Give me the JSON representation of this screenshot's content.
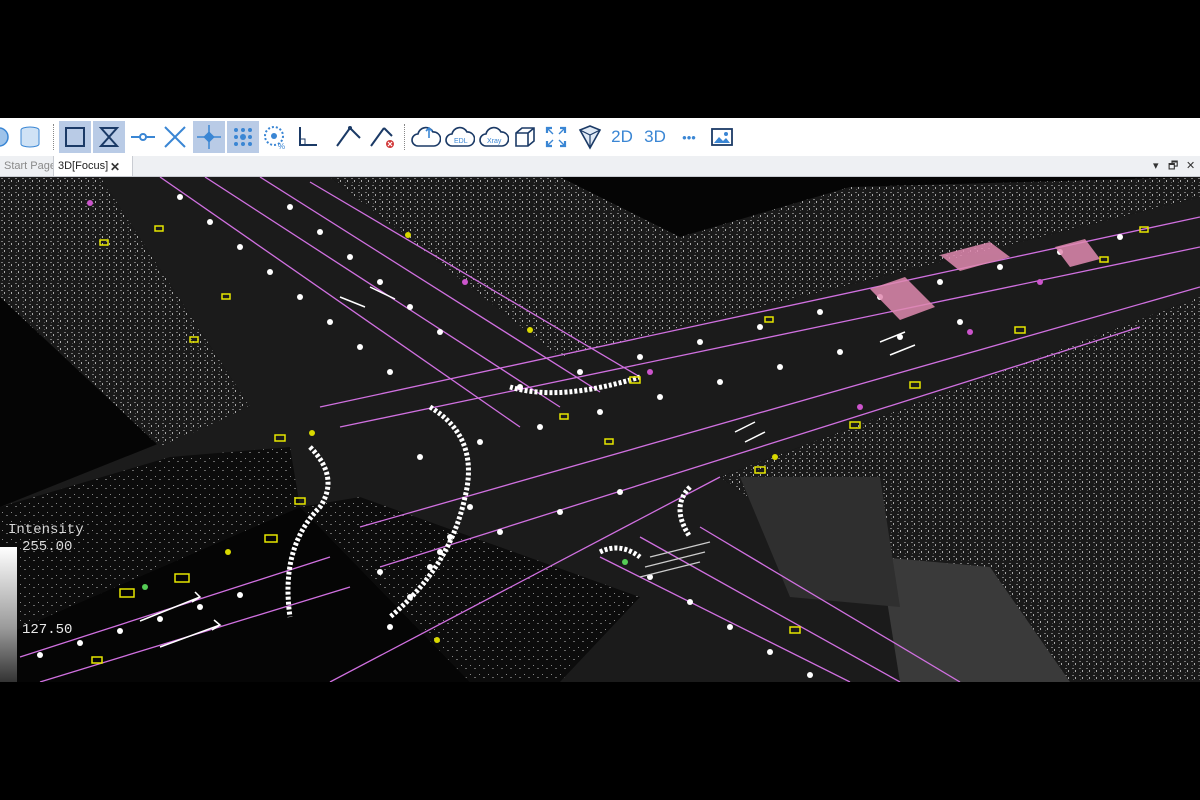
{
  "toolbar": {
    "buttons": [
      {
        "icon": "globe-icon"
      },
      {
        "icon": "database-icon"
      },
      {
        "icon": "rectangle-select-icon",
        "active": true
      },
      {
        "icon": "hourglass-select-icon",
        "active": true
      },
      {
        "icon": "point-on-line-icon"
      },
      {
        "icon": "cross-lines-icon"
      },
      {
        "icon": "snap-point-icon",
        "active": true
      },
      {
        "icon": "snap-grid-icon",
        "active": true
      },
      {
        "icon": "sphere-points-icon"
      },
      {
        "icon": "corner-axis-icon"
      },
      {
        "icon": "measure-angle-icon"
      },
      {
        "icon": "measure-angle-delete-icon"
      },
      {
        "icon": "cloud-up-icon"
      },
      {
        "icon": "cloud-edl-icon"
      },
      {
        "icon": "cloud-xray-icon"
      },
      {
        "icon": "cube-icon"
      },
      {
        "icon": "fullscreen-icon"
      },
      {
        "icon": "view-cube-icon"
      }
    ],
    "mode_2d": "2D",
    "mode_3d": "3D",
    "more_label": "•••",
    "screenshot_icon": "image-icon"
  },
  "tabs": [
    {
      "label": "Start Page",
      "active": false
    },
    {
      "label": "3D[Focus]",
      "active": true,
      "close": "✕"
    }
  ],
  "window_controls": {
    "menu": "▾",
    "restore": "🗗",
    "close": "✕"
  },
  "viewport": {
    "legend": {
      "title": "Intensity",
      "max": "255.00",
      "mid": "127.50"
    },
    "colors": {
      "lane": "#d070e0",
      "marker": "#ffffff",
      "sign": "#e6e600",
      "pole": "#cc55cc"
    }
  }
}
